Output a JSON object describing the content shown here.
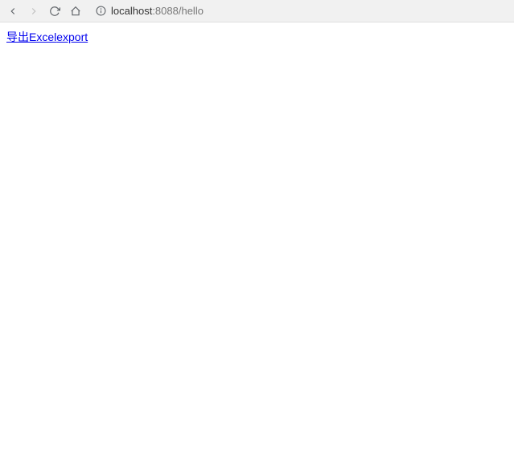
{
  "toolbar": {
    "url_host": "localhost",
    "url_port": ":8088",
    "url_path": "/hello"
  },
  "content": {
    "link1_text": "导出Excel",
    "link2_text": "export"
  }
}
